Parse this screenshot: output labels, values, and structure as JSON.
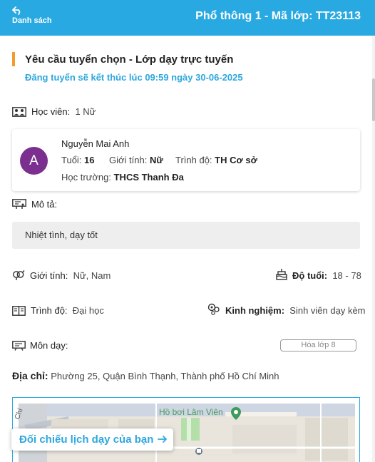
{
  "header": {
    "back_label": "Danh sách",
    "title": "Phổ thông 1 - Mã lớp: TT23113"
  },
  "request": {
    "title": "Yêu cầu tuyển chọn - Lớp dạy trực tuyến",
    "deadline": "Đăng tuyển sẽ kết thúc lúc 09:59 ngày 30-06-2025"
  },
  "students": {
    "label": "Học viên:",
    "value": "1 Nữ",
    "card": {
      "avatar_letter": "A",
      "name": "Nguyễn Mai Anh",
      "age_label": "Tuổi:",
      "age": "16",
      "gender_label": "Giới tính:",
      "gender": "Nữ",
      "level_label": "Trình độ:",
      "level": "TH Cơ sở",
      "school_label": "Học trường:",
      "school": "THCS Thanh Đa"
    }
  },
  "description": {
    "label": "Mô tả:",
    "text": "Nhiệt tình, dạy tốt"
  },
  "requirements": {
    "gender_label": "Giới tính:",
    "gender": "Nữ, Nam",
    "age_label": "Độ tuổi:",
    "age": "18 - 78",
    "level_label": "Trình độ:",
    "level": "Đại học",
    "experience_label": "Kinh nghiệm:",
    "experience": "Sinh viên dạy kèm"
  },
  "subject": {
    "label": "Môn dạy:",
    "tag": "Hóa lớp 8"
  },
  "address": {
    "label": "Địa chỉ:",
    "value": "Phường 25, Quận Bình Thạnh, Thành phố Hồ Chí Minh"
  },
  "map": {
    "poi": "Hồ bơi Lâm Viên",
    "street_fragment": "Chí",
    "compare_button": "Đối chiếu lịch dạy của bạn"
  },
  "colors": {
    "header_bg": "#29a9e1",
    "accent_orange": "#f39c2b",
    "accent_blue": "#2ea7de",
    "avatar_bg": "#7b2f8e"
  }
}
